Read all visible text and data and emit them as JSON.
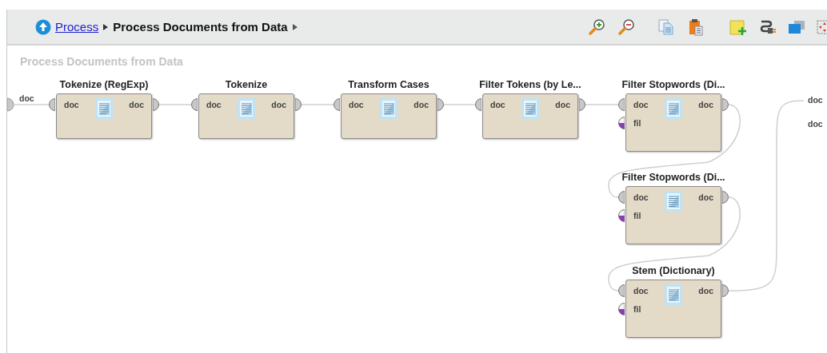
{
  "breadcrumb": {
    "link": "Process",
    "current": "Process Documents from Data"
  },
  "canvas": {
    "title": "Process Documents from Data",
    "input_ports": [
      "doc"
    ],
    "output_ports": [
      "doc",
      "doc"
    ],
    "nodes": [
      {
        "title": "Tokenize (RegExp)",
        "inputs": [
          {
            "label": "doc",
            "kind": "document"
          }
        ],
        "outputs": [
          "doc"
        ]
      },
      {
        "title": "Tokenize",
        "inputs": [
          {
            "label": "doc",
            "kind": "document"
          }
        ],
        "outputs": [
          "doc"
        ]
      },
      {
        "title": "Transform Cases",
        "inputs": [
          {
            "label": "doc",
            "kind": "document"
          }
        ],
        "outputs": [
          "doc"
        ]
      },
      {
        "title": "Filter Tokens (by Le...",
        "inputs": [
          {
            "label": "doc",
            "kind": "document"
          }
        ],
        "outputs": [
          "doc"
        ]
      },
      {
        "title": "Filter Stopwords (Di...",
        "inputs": [
          {
            "label": "doc",
            "kind": "document"
          },
          {
            "label": "fil",
            "kind": "filter"
          }
        ],
        "outputs": [
          "doc"
        ]
      },
      {
        "title": "Filter Stopwords (Di...",
        "inputs": [
          {
            "label": "doc",
            "kind": "document"
          },
          {
            "label": "fil",
            "kind": "filter"
          }
        ],
        "outputs": [
          "doc"
        ]
      },
      {
        "title": "Stem (Dictionary)",
        "inputs": [
          {
            "label": "doc",
            "kind": "document"
          },
          {
            "label": "fil",
            "kind": "filter"
          }
        ],
        "outputs": [
          "doc"
        ]
      }
    ]
  }
}
